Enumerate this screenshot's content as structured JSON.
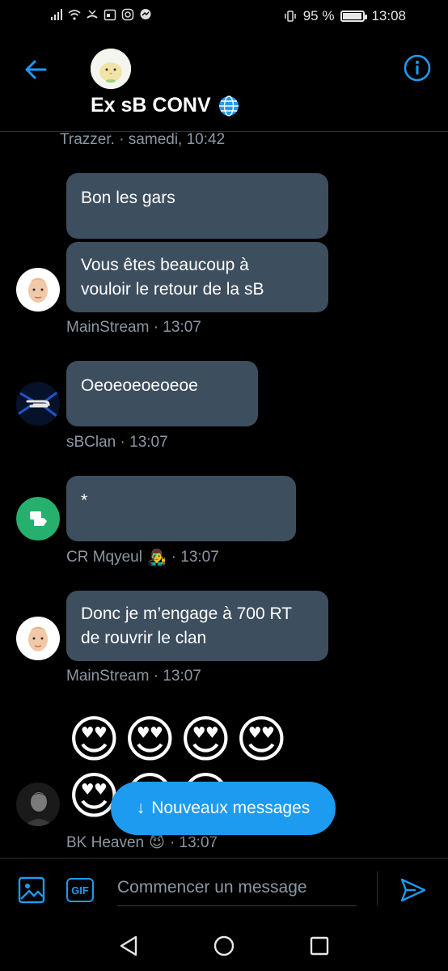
{
  "status_bar": {
    "battery_percent": "95 %",
    "battery_level": 0.95,
    "time": "13:08"
  },
  "header": {
    "title": "Ex sB CONV",
    "title_icon": "globe-icon",
    "back_icon": "arrow-left-icon",
    "info_icon": "info-icon"
  },
  "timeline": {
    "top_timestamp": "Trazzer. · samedi, 10:42"
  },
  "messages": [
    {
      "lines": [
        "Bon les gars"
      ]
    },
    {
      "lines": [
        "Vous êtes beaucoup à",
        "vouloir le retour de la sB"
      ]
    },
    {
      "lines": [
        "Oeoeoeoeoeoe"
      ]
    },
    {
      "lines": [
        "*"
      ]
    },
    {
      "lines": [
        "Donc je m’engage à 700 RT",
        "de rouvrir le clan"
      ]
    },
    {
      "emoji": "😍"
    }
  ],
  "meta": {
    "mainstream_1": "MainStream · 13:07",
    "sbclan": "sBClan · 13:07",
    "crmqyeul_name": "CR Mqyeul",
    "crmqyeul_emoji": "👨‍🎤",
    "crmqyeul_time": "· 13:07",
    "mainstream_2": "MainStream · 13:07",
    "bkheaven_name": "BK Heaven",
    "bkheaven_emoji": "😈",
    "bkheaven_time": "· 13:07"
  },
  "new_messages_button": {
    "arrow": "↓",
    "label": "Nouveaux messages"
  },
  "composer": {
    "placeholder": "Commencer un message",
    "gif_label": "GIF",
    "photo_icon": "image-icon",
    "send_icon": "send-icon"
  },
  "colors": {
    "accent": "#1d9bf0",
    "bubble": "#3d4e5f",
    "secondary_text": "#8b98a5",
    "background": "#000000"
  }
}
